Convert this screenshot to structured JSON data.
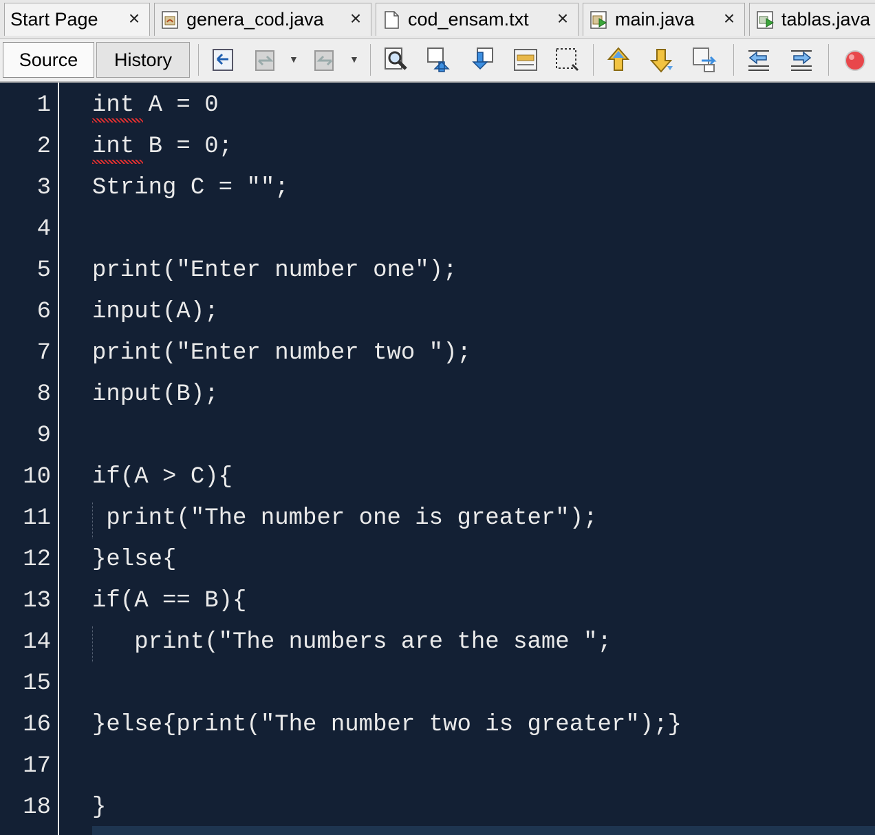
{
  "tabs": [
    {
      "label": "Start Page",
      "icon": "none"
    },
    {
      "label": "genera_cod.java",
      "icon": "java-file-icon"
    },
    {
      "label": "cod_ensam.txt",
      "icon": "text-file-icon"
    },
    {
      "label": "main.java",
      "icon": "java-main-file-icon"
    },
    {
      "label": "tablas.java",
      "icon": "java-run-file-icon"
    }
  ],
  "tab_close_glyph": "×",
  "toolbar": {
    "source_label": "Source",
    "history_label": "History"
  },
  "editor": {
    "background": "#132034",
    "lines": [
      {
        "num": "1",
        "text": "int A = 0"
      },
      {
        "num": "2",
        "text": "int B = 0;"
      },
      {
        "num": "3",
        "text": "String C = \"\";"
      },
      {
        "num": "4",
        "text": ""
      },
      {
        "num": "5",
        "text": "print(\"Enter number one\");"
      },
      {
        "num": "6",
        "text": "input(A);"
      },
      {
        "num": "7",
        "text": "print(\"Enter number two \");"
      },
      {
        "num": "8",
        "text": "input(B);"
      },
      {
        "num": "9",
        "text": ""
      },
      {
        "num": "10",
        "text": "if(A > C){"
      },
      {
        "num": "11",
        "text": " print(\"The number one is greater\");"
      },
      {
        "num": "12",
        "text": "}else{"
      },
      {
        "num": "13",
        "text": "if(A == B){"
      },
      {
        "num": "14",
        "text": "   print(\"The numbers are the same \";"
      },
      {
        "num": "15",
        "text": ""
      },
      {
        "num": "16",
        "text": "}else{print(\"The number two is greater\");}"
      },
      {
        "num": "17",
        "text": ""
      },
      {
        "num": "18",
        "text": "}"
      }
    ]
  }
}
